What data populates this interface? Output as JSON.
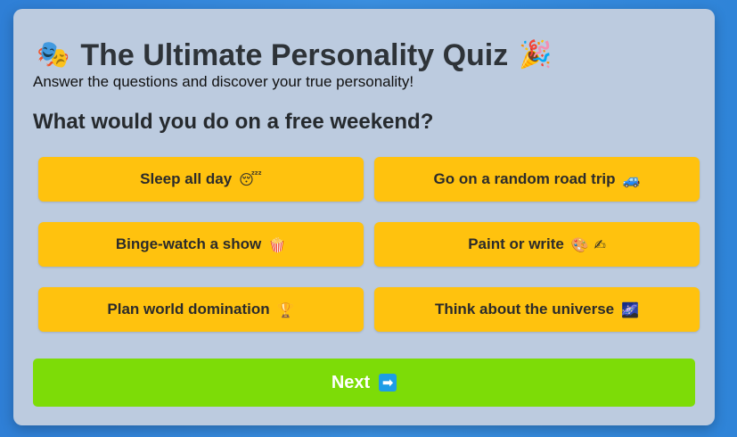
{
  "quiz": {
    "title": "The Ultimate Personality Quiz",
    "title_icon_left": "🎭",
    "title_icon_right": "🎉",
    "subtitle": "Answer the questions and discover your true personality!",
    "question": "What would you do on a free weekend?",
    "options": [
      {
        "label": "Sleep all day",
        "emoji": "😴"
      },
      {
        "label": "Go on a random road trip",
        "emoji": "🚙"
      },
      {
        "label": "Binge-watch a show",
        "emoji": "🍿"
      },
      {
        "label": "Paint or write",
        "emoji": "🎨 ✍"
      },
      {
        "label": "Plan world domination",
        "emoji": "🏆"
      },
      {
        "label": "Think about the universe",
        "emoji": "🌌"
      }
    ],
    "next_label": "Next",
    "next_icon": "➡"
  },
  "colors": {
    "background": "#2f7fd6",
    "card": "#bccbdf",
    "option": "#ffc20e",
    "next_button": "#7ddc07",
    "arrow_badge": "#1e9de6"
  }
}
